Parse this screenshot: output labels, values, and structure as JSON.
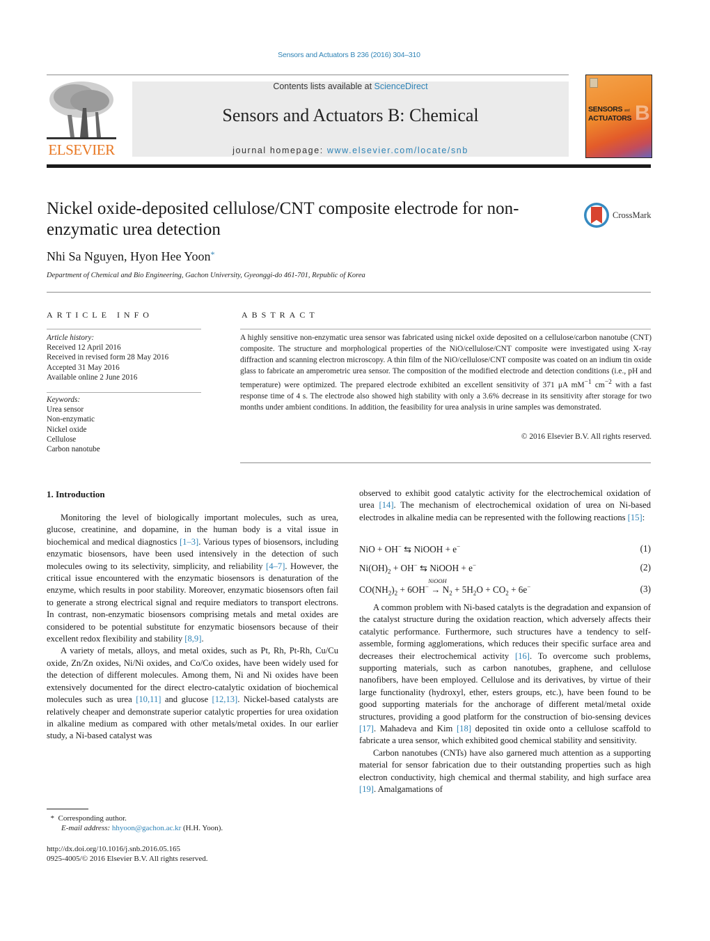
{
  "header": {
    "journal_ref": "Sensors and Actuators B 236 (2016) 304–310",
    "contents_prefix": "Contents lists available at ",
    "contents_link": "ScienceDirect",
    "journal_title": "Sensors and Actuators B: Chemical",
    "homepage_prefix": "journal homepage: ",
    "homepage_link": "www.elsevier.com/locate/snb",
    "publisher_logo": "ELSEVIER",
    "cover": {
      "title_line1": "SENSORS",
      "title_and": "and",
      "title_line2": "ACTUATORS",
      "letter": "B"
    },
    "colors": {
      "link": "#2e83b6",
      "elsevier_orange": "#e87722",
      "banner_bg": "#ebebeb"
    }
  },
  "article": {
    "title": "Nickel oxide-deposited cellulose/CNT composite electrode for non-enzymatic urea detection",
    "crossmark_label": "CrossMark",
    "authors": "Nhi Sa Nguyen, Hyon Hee Yoon",
    "author_mark": "*",
    "affiliation": "Department of Chemical and Bio Engineering, Gachon University, Gyeonggi-do 461-701, Republic of Korea"
  },
  "article_info": {
    "label": "ARTICLE INFO",
    "history_heading": "Article history:",
    "history": [
      "Received 12 April 2016",
      "Received in revised form 28 May 2016",
      "Accepted 31 May 2016",
      "Available online 2 June 2016"
    ],
    "keywords_heading": "Keywords:",
    "keywords": [
      "Urea sensor",
      "Non-enzymatic",
      "Nickel oxide",
      "Cellulose",
      "Carbon nanotube"
    ]
  },
  "abstract": {
    "label": "ABSTRACT",
    "text_part1": "A highly sensitive non-enzymatic urea sensor was fabricated using nickel oxide deposited on a cellulose/carbon nanotube (CNT) composite. The structure and morphological properties of the NiO/cellulose/CNT composite were investigated using X-ray diffraction and scanning electron microscopy. A thin film of the NiO/cellulose/CNT composite was coated on an indium tin oxide glass to fabricate an amperometric urea sensor. The composition of the modified electrode and detection conditions (i.e., pH and temperature) were optimized. The prepared electrode exhibited an excellent sensitivity of 371 μA mM",
    "sup1": "−1",
    "mid": " cm",
    "sup2": "−2",
    "text_part2": " with a fast response time of 4 s. The electrode also showed high stability with only a 3.6% decrease in its sensitivity after storage for two months under ambient conditions. In addition, the feasibility for urea analysis in urine samples was demonstrated.",
    "copyright": "© 2016 Elsevier B.V. All rights reserved."
  },
  "intro": {
    "heading": "1.  Introduction",
    "p1": [
      {
        "t": "Monitoring the level of biologically important molecules, such as urea, glucose, creatinine, and dopamine, in the human body is a vital issue in biochemical and medical diagnostics "
      },
      {
        "ref": "[1–3]"
      },
      {
        "t": ". Various types of biosensors, including enzymatic biosensors, have been used intensively in the detection of such molecules owing to its selectivity, simplicity, and reliability "
      },
      {
        "ref": "[4–7]"
      },
      {
        "t": ". However, the critical issue encountered with the enzymatic biosensors is denaturation of the enzyme, which results in poor stability. Moreover, enzymatic biosensors often fail to generate a strong electrical signal and require mediators to transport electrons. In contrast, non-enzymatic biosensors comprising metals and metal oxides are considered to be potential substitute for enzymatic biosensors because of their excellent redox flexibility and stability "
      },
      {
        "ref": "[8,9]"
      },
      {
        "t": "."
      }
    ],
    "p2": [
      {
        "t": "A variety of metals, alloys, and metal oxides, such as Pt, Rh, Pt-Rh, Cu/Cu oxide, Zn/Zn oxides, Ni/Ni oxides, and Co/Co oxides, have been widely used for the detection of different molecules. Among them, Ni and Ni oxides have been extensively documented for the direct electro-catalytic oxidation of biochemical molecules such as urea "
      },
      {
        "ref": "[10,11]"
      },
      {
        "t": " and glucose "
      },
      {
        "ref": "[12,13]"
      },
      {
        "t": ". Nickel-based catalysts are relatively cheaper and demonstrate superior catalytic properties for urea oxidation in alkaline medium as compared with other metals/metal oxides. In our earlier study, a Ni-based catalyst was"
      }
    ],
    "p3": [
      {
        "t": "observed to exhibit good catalytic activity for the electrochemical oxidation of urea "
      },
      {
        "ref": "[14]"
      },
      {
        "t": ". The mechanism of electrochemical oxidation of urea on Ni-based electrodes in alkaline media can be represented with the following reactions "
      },
      {
        "ref": "[15]"
      },
      {
        "t": ":"
      }
    ],
    "equations": [
      {
        "number": "(1)"
      },
      {
        "number": "(2)"
      },
      {
        "number": "(3)",
        "catalyst": "NiOOH"
      }
    ],
    "p4": [
      {
        "t": "A common problem with Ni-based catalyts is the degradation and expansion of the catalyst structure during the oxidation reaction, which adversely affects their catalytic performance. Furthermore, such structures have a tendency to self-assemble, forming agglomerations, which reduces their specific surface area and decreases their electrochemical activity "
      },
      {
        "ref": "[16]"
      },
      {
        "t": ". To overcome such problems, supporting materials, such as carbon nanotubes, graphene, and cellulose nanofibers, have been employed. Cellulose and its derivatives, by virtue of their large functionality (hydroxyl, ether, esters groups, etc.), have been found to be good supporting materials for the anchorage of different metal/metal oxide structures, providing a good platform for the construction of bio-sensing devices "
      },
      {
        "ref": "[17]"
      },
      {
        "t": ". Mahadeva and Kim "
      },
      {
        "ref": "[18]"
      },
      {
        "t": " deposited tin oxide onto a cellulose scaffold to fabricate a urea sensor, which exhibited good chemical stability and sensitivity."
      }
    ],
    "p5": [
      {
        "t": "Carbon nanotubes (CNTs) have also garnered much attention as a supporting material for sensor fabrication due to their outstanding properties such as high electron conductivity, high chemical and thermal stability, and high surface area "
      },
      {
        "ref": "[19]"
      },
      {
        "t": ". Amalgamations of"
      }
    ]
  },
  "footnote": {
    "mark": "*",
    "corresponding": "Corresponding author.",
    "email_label": "E-mail address: ",
    "email": "hhyoon@gachon.ac.kr",
    "email_suffix": " (H.H. Yoon).",
    "doi": "http://dx.doi.org/10.1016/j.snb.2016.05.165",
    "issn": "0925-4005/© 2016 Elsevier B.V. All rights reserved."
  }
}
